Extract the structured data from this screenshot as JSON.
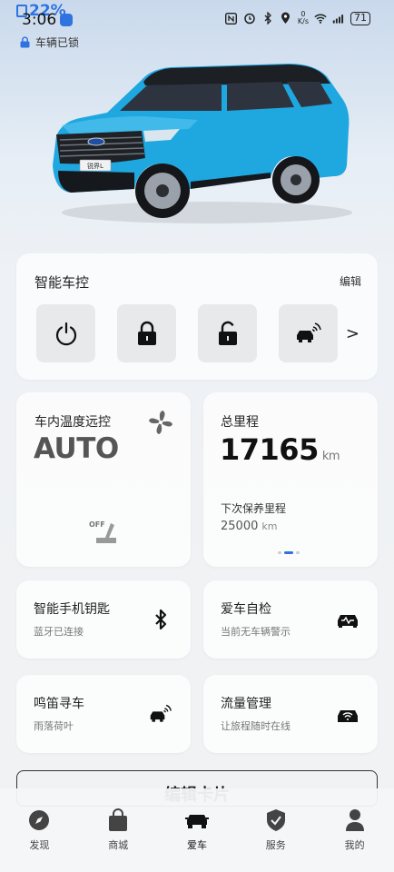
{
  "status_bar": {
    "battery_percent": "22%",
    "time": "3:06",
    "net_speed_value": "0",
    "net_speed_unit": "K/s",
    "phone_battery": "71"
  },
  "lock_status": "车辆已锁",
  "car_badge": "锐界L",
  "smart_control": {
    "title": "智能车控",
    "edit_label": "编辑",
    "buttons": [
      "power-icon",
      "lock-icon",
      "unlock-icon",
      "horn-car-icon"
    ],
    "more_arrow": ">"
  },
  "climate": {
    "title": "车内温度远控",
    "value": "AUTO",
    "seat_heat": "OFF"
  },
  "odometer": {
    "title": "总里程",
    "value": "17165",
    "unit": "km",
    "next_service_label": "下次保养里程",
    "next_service_value": "25000",
    "next_service_unit": "km"
  },
  "phone_key": {
    "title": "智能手机钥匙",
    "subtitle": "蓝牙已连接"
  },
  "self_check": {
    "title": "爱车自检",
    "subtitle": "当前无车辆警示"
  },
  "horn_find": {
    "title": "鸣笛寻车",
    "subtitle": "雨落荷叶"
  },
  "data_manage": {
    "title": "流量管理",
    "subtitle": "让旅程随时在线"
  },
  "edit_cards_label": "编辑卡片",
  "nav": [
    {
      "label": "发现",
      "icon": "compass-icon"
    },
    {
      "label": "商城",
      "icon": "bag-icon"
    },
    {
      "label": "爱车",
      "icon": "car-icon"
    },
    {
      "label": "服务",
      "icon": "shield-check-icon"
    },
    {
      "label": "我的",
      "icon": "person-icon"
    }
  ],
  "colors": {
    "accent": "#2f73e0",
    "car_body": "#1fa7e0"
  }
}
